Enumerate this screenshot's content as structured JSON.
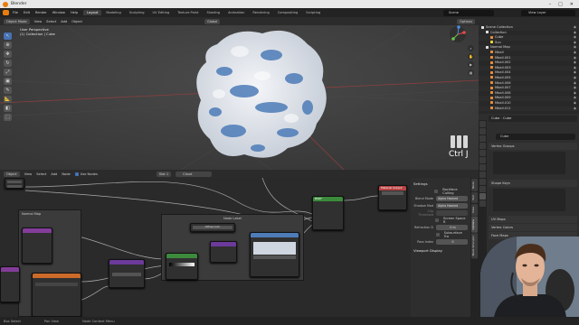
{
  "window": {
    "title": "Blender",
    "controls": [
      "–",
      "□",
      "✕"
    ]
  },
  "menu": [
    "File",
    "Edit",
    "Render",
    "Window",
    "Help"
  ],
  "workspaces": [
    "Layout",
    "Modeling",
    "Sculpting",
    "UV Editing",
    "Texture Paint",
    "Shading",
    "Animation",
    "Rendering",
    "Compositing",
    "Scripting"
  ],
  "active_workspace": "Layout",
  "scene": "Scene",
  "view_layer": "View Layer",
  "viewport": {
    "mode": "Object Mode",
    "menus": [
      "View",
      "Select",
      "Add",
      "Object"
    ],
    "orientation": "Global",
    "info_line1": "User Perspective",
    "info_line2": "(1) Collection | Cube",
    "keycast": "Ctrl J",
    "options": "Options"
  },
  "node_header": {
    "editor": "Object",
    "menus": [
      "View",
      "Select",
      "Add",
      "Node"
    ],
    "use_nodes": "Use Nodes",
    "slot": "Slot 1",
    "material": "Cloud"
  },
  "nodes": {
    "frame_label": "Normal Map",
    "group_label": "Node Label",
    "diffuse_label": "Diffuse Color",
    "principled": "BSDF",
    "output": "Material Output",
    "mix": "Mix Shader"
  },
  "sidebar": {
    "settings_title": "Settings",
    "backface": "Backface Culling",
    "blend_mode_label": "Blend Mode",
    "blend_mode": "Alpha Hashed",
    "shadow_mode_label": "Shadow Mod",
    "shadow_mode": "Alpha Hashed",
    "clip_label": "Clip Threshold",
    "screen_space": "Screen Space R",
    "refraction_label": "Refraction D",
    "refraction_value": "0 m",
    "subsurface": "Subsurface Tra",
    "pass_index_label": "Pass Index",
    "pass_index_value": "0",
    "viewport_display": "Viewport Display",
    "tabs": [
      "Node",
      "Tool",
      "View",
      "Options",
      "Node Wrangler"
    ]
  },
  "outliner": {
    "rows": [
      {
        "name": "Scene Collection",
        "indent": 0,
        "icon": "collection"
      },
      {
        "name": "Collection",
        "indent": 1,
        "icon": "collection"
      },
      {
        "name": "Cube",
        "indent": 2,
        "icon": "mesh"
      },
      {
        "name": "Sun",
        "indent": 2,
        "icon": "light"
      },
      {
        "name": "Normal Map",
        "indent": 1,
        "icon": "collection"
      },
      {
        "name": "Mball",
        "indent": 2,
        "icon": "mball"
      },
      {
        "name": "Mball.001",
        "indent": 2,
        "icon": "mball"
      },
      {
        "name": "Mball.002",
        "indent": 2,
        "icon": "mball"
      },
      {
        "name": "Mball.003",
        "indent": 2,
        "icon": "mball"
      },
      {
        "name": "Mball.004",
        "indent": 2,
        "icon": "mball"
      },
      {
        "name": "Mball.005",
        "indent": 2,
        "icon": "mball"
      },
      {
        "name": "Mball.006",
        "indent": 2,
        "icon": "mball"
      },
      {
        "name": "Mball.007",
        "indent": 2,
        "icon": "mball"
      },
      {
        "name": "Mball.008",
        "indent": 2,
        "icon": "mball"
      },
      {
        "name": "Mball.009",
        "indent": 2,
        "icon": "mball"
      },
      {
        "name": "Mball.010",
        "indent": 2,
        "icon": "mball"
      },
      {
        "name": "Mball.011",
        "indent": 2,
        "icon": "mball"
      }
    ]
  },
  "properties": {
    "object": "Cube",
    "data": "Cube",
    "mesh": "Cube",
    "sections": [
      "Vertex Groups",
      "Shape Keys",
      "UV Maps",
      "Vertex Colors",
      "Face Maps"
    ]
  },
  "statusbar": [
    "Box Select",
    "Pan View",
    "Node Context Menu"
  ],
  "colors": {
    "accent": "#4772b3",
    "blender_orange": "#e87d0d",
    "cloud_blue": "#4d7cb8"
  }
}
